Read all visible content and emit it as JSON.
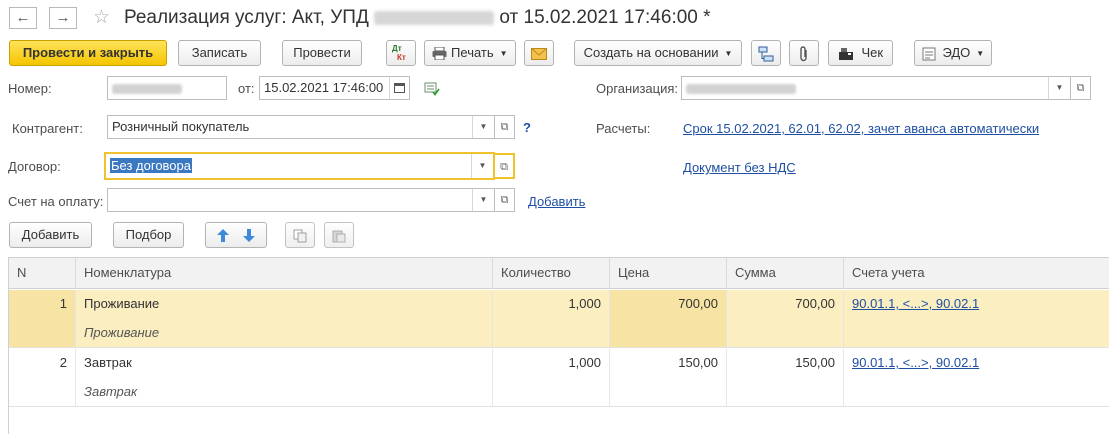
{
  "window": {
    "title_prefix": "Реализация услуг: Акт, УПД",
    "title_suffix": "от 15.02.2021 17:46:00 *",
    "back_glyph": "←",
    "forward_glyph": "→",
    "star_glyph": "☆"
  },
  "toolbar": {
    "post_close": "Провести и закрыть",
    "save": "Записать",
    "post": "Провести",
    "dtkt_top": "Дт",
    "dtkt_bottom": "Кт",
    "print": "Печать",
    "create_based": "Создать на основании",
    "receipt": "Чек",
    "edo": "ЭДО"
  },
  "form": {
    "number_label": "Номер:",
    "from_label": "от:",
    "date_value": "15.02.2021 17:46:00",
    "organization_label": "Организация:",
    "counterparty_label": "Контрагент:",
    "counterparty_value": "Розничный покупатель",
    "help_mark": "?",
    "settlements_label": "Расчеты:",
    "settlements_link": "Срок 15.02.2021, 62.01, 62.02, зачет аванса автоматически",
    "contract_label": "Договор:",
    "contract_value": "Без договора",
    "vat_link": "Документ без НДС",
    "invoice_label": "Счет на оплату:",
    "invoice_add_link": "Добавить"
  },
  "table_toolbar": {
    "add": "Добавить",
    "pick": "Подбор"
  },
  "table": {
    "columns": [
      "N",
      "Номенклатура",
      "Количество",
      "Цена",
      "Сумма",
      "Счета учета"
    ],
    "rows": [
      {
        "n": "1",
        "item": "Проживание",
        "item_sub": "Проживание",
        "qty": "1,000",
        "price": "700,00",
        "sum": "700,00",
        "accounts": "90.01.1, <...>, 90.02.1"
      },
      {
        "n": "2",
        "item": "Завтрак",
        "item_sub": "Завтрак",
        "qty": "1,000",
        "price": "150,00",
        "sum": "150,00",
        "accounts": "90.01.1, <...>, 90.02.1"
      }
    ]
  },
  "colors": {
    "primary_button": "#f4c500",
    "selected_row": "#fbeec0",
    "link": "#1f4fa3",
    "focus_border": "#f0c22e"
  }
}
